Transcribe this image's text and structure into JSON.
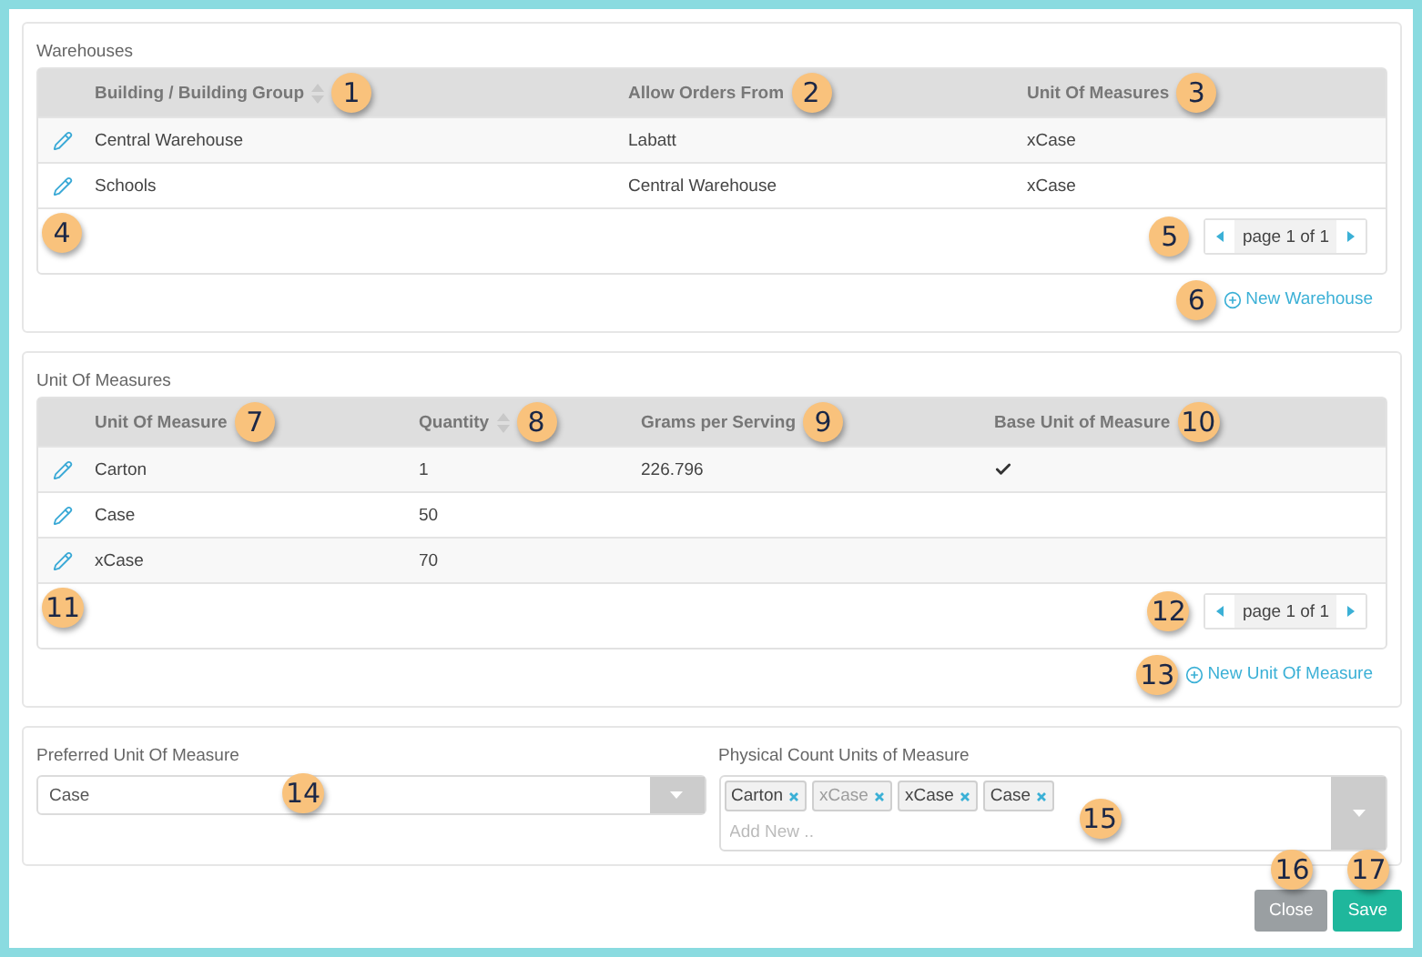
{
  "warehouses": {
    "title": "Warehouses",
    "columns": [
      {
        "label": "Building / Building Group",
        "sortable": true,
        "callout": "1"
      },
      {
        "label": "Allow Orders From",
        "sortable": false,
        "callout": "2"
      },
      {
        "label": "Unit Of Measures",
        "sortable": false,
        "callout": "3"
      }
    ],
    "rows": [
      {
        "cells": [
          "Central Warehouse",
          "Labatt",
          "xCase"
        ]
      },
      {
        "cells": [
          "Schools",
          "Central Warehouse",
          "xCase"
        ]
      }
    ],
    "footer_callout": "4",
    "pager": {
      "label": "page 1 of 1",
      "callout": "5"
    },
    "add_link": {
      "label": "New Warehouse",
      "callout": "6"
    }
  },
  "units": {
    "title": "Unit Of Measures",
    "columns": [
      {
        "label": "Unit Of Measure",
        "sortable": false,
        "callout": "7"
      },
      {
        "label": "Quantity",
        "sortable": true,
        "callout": "8"
      },
      {
        "label": "Grams per Serving",
        "sortable": false,
        "callout": "9"
      },
      {
        "label": "Base Unit of Measure",
        "sortable": false,
        "callout": "10"
      }
    ],
    "rows": [
      {
        "cells": [
          "Carton",
          "1",
          "226.796"
        ],
        "base": true
      },
      {
        "cells": [
          "Case",
          "50"
        ],
        "base": false
      },
      {
        "cells": [
          "xCase",
          "70"
        ],
        "base": false
      }
    ],
    "footer_callout": "11",
    "pager": {
      "label": "page 1 of 1",
      "callout": "12"
    },
    "add_link": {
      "label": "New Unit Of Measure",
      "callout": "13"
    }
  },
  "preferred": {
    "label": "Preferred Unit Of Measure",
    "value": "Case",
    "callout": "14"
  },
  "physical_count": {
    "label": "Physical Count Units of Measure",
    "tags": [
      {
        "label": "Carton",
        "disabled": false
      },
      {
        "label": "xCase",
        "disabled": true
      },
      {
        "label": "xCase",
        "disabled": false
      },
      {
        "label": "Case",
        "disabled": false
      }
    ],
    "placeholder": "Add New ..",
    "callout": "15"
  },
  "buttons": [
    {
      "label": "Close",
      "kind": "secondary",
      "callout": "16"
    },
    {
      "label": "Save",
      "kind": "primary",
      "callout": "17"
    }
  ]
}
